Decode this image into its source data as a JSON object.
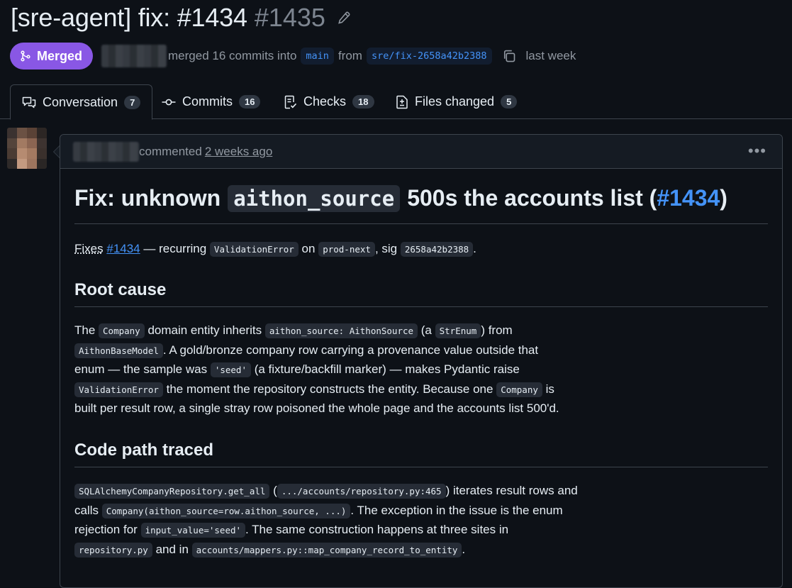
{
  "pr": {
    "title": "[sre-agent] fix: #1434",
    "number": "#1435",
    "status": "Merged",
    "meta_text": "merged 16 commits into",
    "base_branch": "main",
    "from_text": "from",
    "head_branch": "sre/fix-2658a42b2388",
    "time": "last week"
  },
  "tabs": [
    {
      "label": "Conversation",
      "count": "7",
      "icon": "comment-discussion-icon"
    },
    {
      "label": "Commits",
      "count": "16",
      "icon": "git-commit-icon"
    },
    {
      "label": "Checks",
      "count": "18",
      "icon": "checklist-icon"
    },
    {
      "label": "Files changed",
      "count": "5",
      "icon": "file-diff-icon"
    }
  ],
  "comment": {
    "action": "commented",
    "time": "2 weeks ago",
    "heading": {
      "pre": "Fix: unknown",
      "code": "aithon_source",
      "mid": "500s the accounts list (",
      "link": "#1434",
      "post": ")"
    },
    "intro": {
      "fixes": "Fixes",
      "link": "#1434",
      "t1": "— recurring",
      "c1": "ValidationError",
      "t2": "on",
      "c2": "prod-next",
      "t3": ", sig",
      "c3": "2658a42b2388",
      "t4": "."
    },
    "root_cause_heading": "Root cause",
    "root_cause": {
      "t1": "The",
      "c1": "Company",
      "t2": "domain entity inherits",
      "c2": "aithon_source: AithonSource",
      "t3": "(a",
      "c3": "StrEnum",
      "t4": ") from",
      "c4": "AithonBaseModel",
      "t5": ". A gold/bronze company row carrying a provenance value outside that enum — the sample was",
      "c5": "'seed'",
      "t6": "(a fixture/backfill marker) — makes Pydantic raise",
      "c6": "ValidationError",
      "t7": "the moment the repository constructs the entity. Because one",
      "c7": "Company",
      "t8": "is built per result row, a single stray row poisoned the whole page and the accounts list 500'd."
    },
    "code_path_heading": "Code path traced",
    "code_path": {
      "c1": "SQLAlchemyCompanyRepository.get_all",
      "t1": "(",
      "c2": ".../accounts/repository.py:465",
      "t2": ") iterates result rows and calls",
      "c3": "Company(aithon_source=row.aithon_source, ...)",
      "t3": ". The exception in the issue is the enum rejection for",
      "c4": "input_value='seed'",
      "t4": ". The same construction happens at three sites in",
      "c5": "repository.py",
      "t5": "and in",
      "c6": "accounts/mappers.py::map_company_record_to_entity",
      "t6": "."
    }
  },
  "colors": {
    "merged": "#8957e5",
    "link": "#4493f8",
    "background": "#0d1117"
  }
}
